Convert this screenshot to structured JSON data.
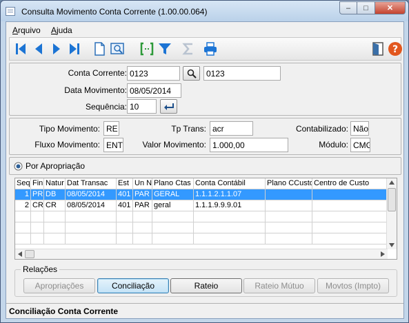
{
  "window": {
    "title": "Consulta Movimento Conta Corrente (1.00.00.064)"
  },
  "menu": [
    {
      "label": "Arquivo",
      "mnemonic": "A",
      "rest": "rquivo"
    },
    {
      "label": "Ajuda",
      "mnemonic": "A",
      "rest": "juda"
    }
  ],
  "toolbar": {
    "icons": [
      "first-record-icon",
      "previous-record-icon",
      "next-record-icon",
      "last-record-icon",
      "new-document-icon",
      "preview-icon",
      "bracket-select-icon",
      "filter-icon",
      "sum-icon",
      "print-icon",
      "exit-door-icon",
      "help-icon"
    ],
    "help_glyph": "?"
  },
  "header": {
    "conta_corrente_label": "Conta Corrente:",
    "conta_corrente_value": "0123",
    "conta_corrente_desc": "0123",
    "data_movimento_label": "Data Movimento:",
    "data_movimento_value": "08/05/2014",
    "sequencia_label": "Sequência:",
    "sequencia_value": "10"
  },
  "details": {
    "tipo_movimento_label": "Tipo Movimento:",
    "tipo_movimento_value": "RE",
    "tp_trans_label": "Tp Trans:",
    "tp_trans_value": "acr",
    "contabilizado_label": "Contabilizado:",
    "contabilizado_value": "Não",
    "fluxo_movimento_label": "Fluxo Movimento:",
    "fluxo_movimento_value": "ENT",
    "valor_movimento_label": "Valor Movimento:",
    "valor_movimento_value": "1.000,00",
    "modulo_label": "Módulo:",
    "modulo_value": "CMG"
  },
  "radio": {
    "label": "Por Apropriação",
    "checked": true
  },
  "grid": {
    "columns": [
      "Seq",
      "Fin",
      "Natur",
      "Dat Transac",
      "Est",
      "Un N",
      "Plano Ctas",
      "Conta Contábil",
      "Plano CCusto",
      "Centro de Custo"
    ],
    "rows": [
      [
        "1",
        "PR",
        "DB",
        "08/05/2014",
        "401",
        "PAR",
        "GERAL",
        "1.1.1.2.1.1.07",
        "",
        ""
      ],
      [
        "2",
        "CR",
        "CR",
        "08/05/2014",
        "401",
        "PAR",
        "geral",
        "1.1.1.9.9.9.01",
        "",
        ""
      ]
    ],
    "selected_row": 0
  },
  "relacoes": {
    "title": "Relações",
    "buttons": [
      {
        "label": "Apropriações",
        "enabled": false
      },
      {
        "label": "Conciliação",
        "enabled": true
      },
      {
        "label": "Rateio",
        "enabled": true
      },
      {
        "label": "Rateio Mútuo",
        "enabled": false
      },
      {
        "label": "Movtos (Impto)",
        "enabled": false
      }
    ]
  },
  "status": {
    "text": "Conciliação Conta Corrente"
  },
  "colors": {
    "selection": "#3399ff",
    "titlebar": "#bad1e9",
    "close": "#c4432f",
    "toolbar_icon": "#1c74d4"
  }
}
